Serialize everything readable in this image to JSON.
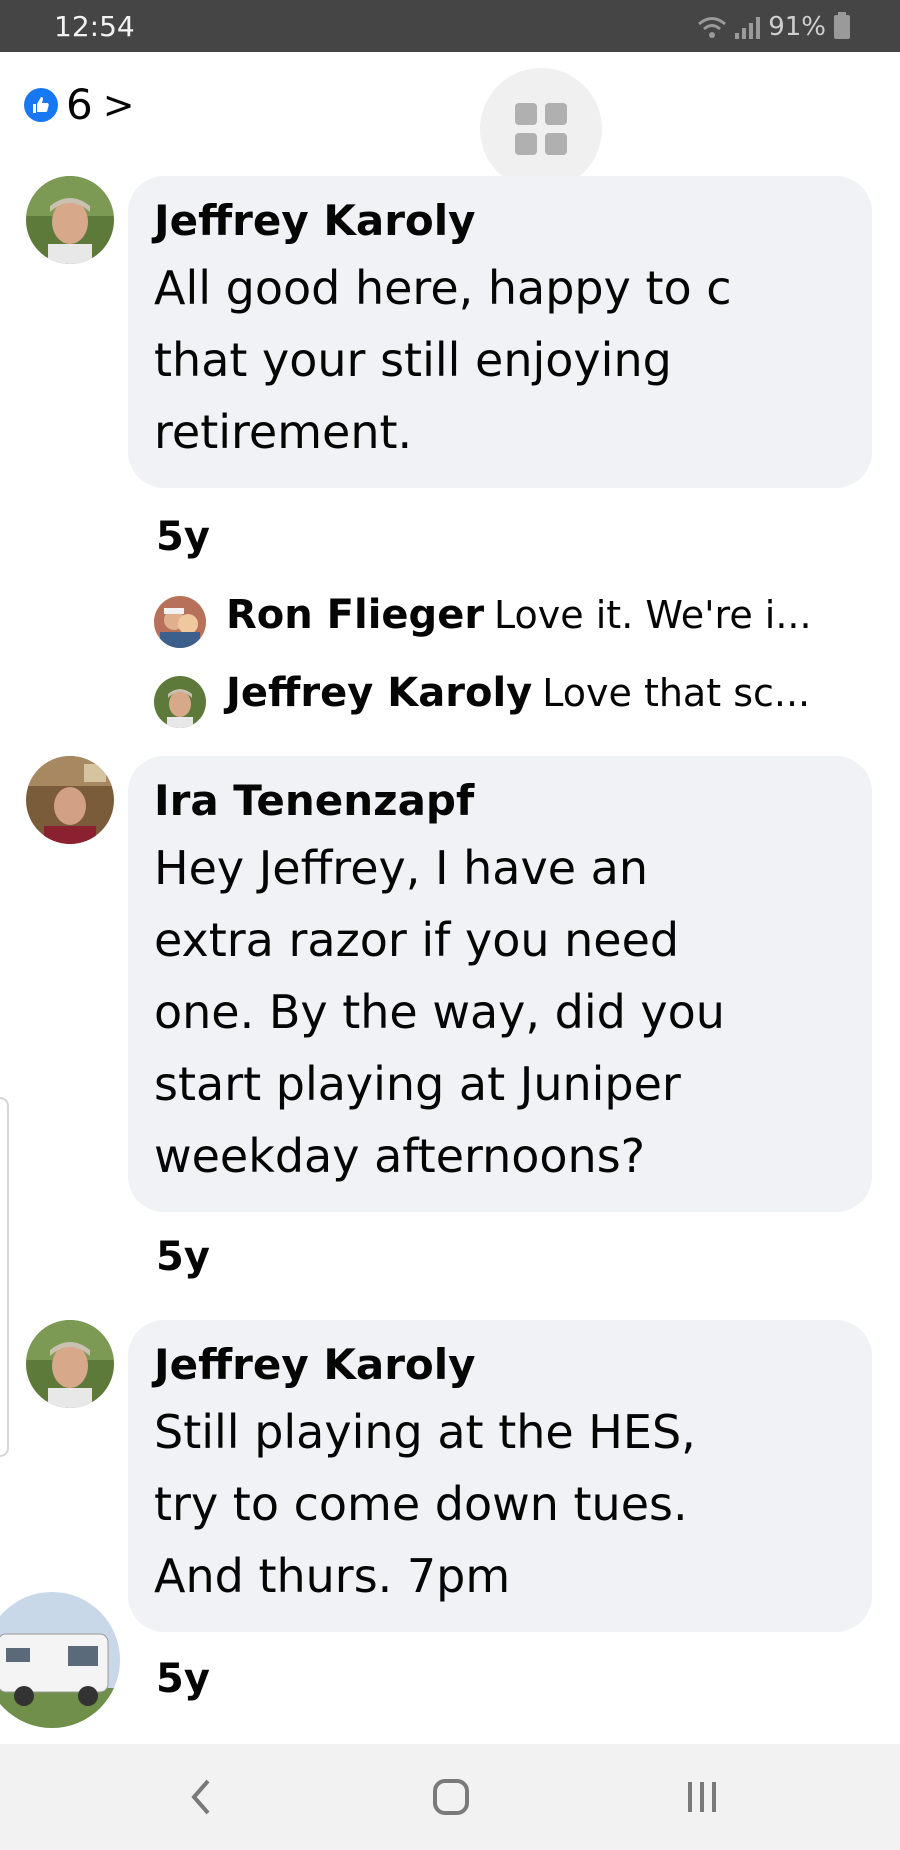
{
  "status_bar": {
    "time": "12:54",
    "battery": "91%"
  },
  "reactions": {
    "count": "6",
    "chevron": ">"
  },
  "comments": [
    {
      "author": "Jeffrey Karoly",
      "text": "All good here, happy to c\nthat your still enjoying\nretirement.",
      "time": "5y"
    },
    {
      "author": "Ira Tenenzapf",
      "text": "Hey Jeffrey, I have an\nextra razor if you need\none. By the way, did you\nstart playing at Juniper\nweekday afternoons?",
      "time": "5y"
    },
    {
      "author": "Jeffrey Karoly",
      "text": "Still playing at the HES,\ntry to come down tues.\nAnd thurs. 7pm",
      "time": "5y"
    }
  ],
  "replies": [
    {
      "author": "Ron Flieger",
      "text": "Love it. We're i..."
    },
    {
      "author": "Jeffrey Karoly",
      "text": "Love that sc..."
    }
  ],
  "nav": {
    "back_icon": "chevron-left-icon",
    "home_icon": "home-square-icon",
    "recents_icon": "recents-bars-icon"
  },
  "colors": {
    "like_blue": "#1877f2",
    "bubble": "#f0f2f5",
    "status_bar": "#454545"
  }
}
